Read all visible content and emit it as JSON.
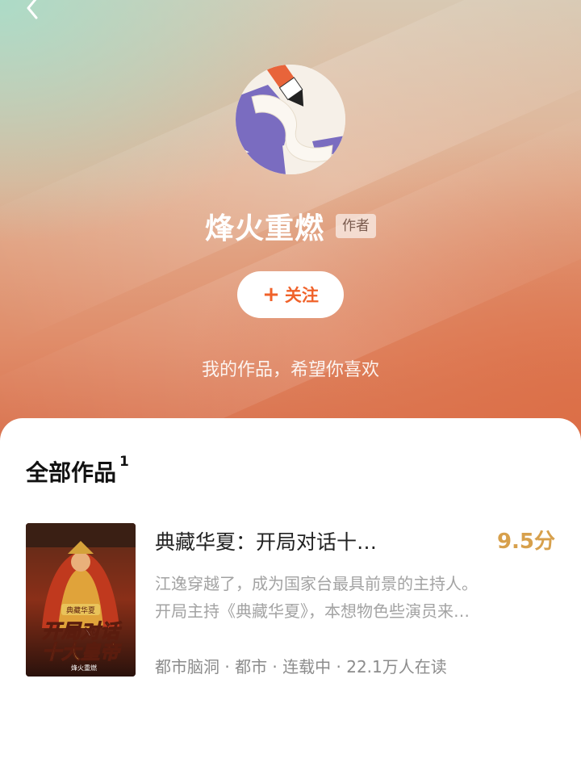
{
  "author": {
    "name": "烽火重燃",
    "badge": "作者",
    "follow_label": "关注",
    "follow_icon": "+",
    "bio": "我的作品，希望你喜欢"
  },
  "works": {
    "title": "全部作品",
    "count": "1",
    "items": [
      {
        "title": "典藏华夏：开局对话十…",
        "score": "9.5分",
        "desc_line1": "江逸穿越了，成为国家台最具前景的主持人。",
        "desc_line2": "开局主持《典藏华夏》，本想物色些演员来…",
        "meta": "都市脑洞 · 都市 · 连载中 · 22.1万人在读",
        "cover_small_title": "典藏华夏",
        "cover_big_line1": "开局对话",
        "cover_big_line2": "十大皇帝",
        "cover_author": "烽火重燃"
      }
    ]
  },
  "colors": {
    "accent": "#f0622a",
    "score": "#d7a04c"
  },
  "icons": {
    "back": "chevron-left-icon",
    "avatar": "pen-paper-avatar"
  }
}
